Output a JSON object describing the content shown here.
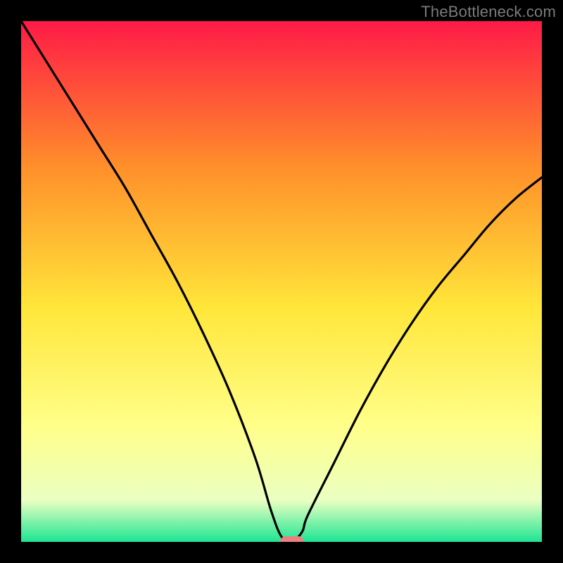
{
  "watermark": "TheBottleneck.com",
  "colors": {
    "frame": "#000000",
    "grad_top": "#ff1a47",
    "grad_mid1": "#ff8f2a",
    "grad_mid2": "#ffe63a",
    "grad_mid3": "#ffff8a",
    "grad_mid4": "#eaffc2",
    "grad_bottom": "#1de593",
    "curve": "#000000",
    "marker": "#ea8080",
    "watermark": "#7b7b7b"
  },
  "chart_data": {
    "type": "line",
    "title": "",
    "xlabel": "",
    "ylabel": "",
    "xlim": [
      0,
      100
    ],
    "ylim": [
      0,
      100
    ],
    "x": [
      0,
      5,
      10,
      15,
      20,
      25,
      30,
      35,
      40,
      45,
      48,
      50,
      52,
      54,
      55,
      60,
      65,
      70,
      75,
      80,
      85,
      90,
      95,
      100
    ],
    "values": [
      100,
      92,
      84,
      76,
      68,
      59,
      50,
      40,
      29,
      16,
      6,
      1,
      0,
      2,
      5,
      15,
      25,
      34,
      42,
      49,
      55,
      61,
      66,
      70
    ],
    "marker": {
      "x": 52,
      "y": 0
    },
    "annotations": []
  }
}
